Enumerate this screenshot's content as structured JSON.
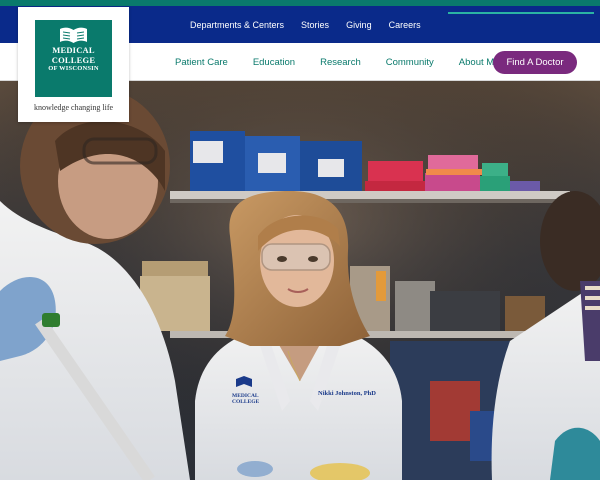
{
  "brand": {
    "logo_lines": [
      "MEDICAL",
      "COLLEGE",
      "OF WISCONSIN"
    ],
    "tagline": "knowledge changing life",
    "colors": {
      "teal": "#0a7a6c",
      "navy": "#0a2a8a",
      "purple": "#7a2a7e"
    }
  },
  "utility_nav": [
    "Departments & Centers",
    "Stories",
    "Giving",
    "Careers"
  ],
  "main_nav": [
    "Patient Care",
    "Education",
    "Research",
    "Community",
    "About MCW"
  ],
  "cta": {
    "label": "Find A Doctor"
  },
  "hero": {
    "coat_labels": {
      "center_name": "Nikki Johnston, PhD"
    }
  },
  "icons": {
    "logo": "open-book-icon"
  }
}
